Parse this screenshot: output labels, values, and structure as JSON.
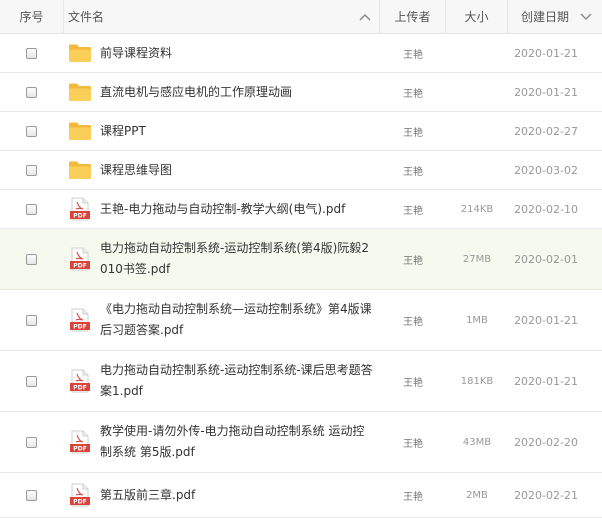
{
  "header": {
    "index": "序号",
    "name": "文件名",
    "uploader": "上传者",
    "size": "大小",
    "created": "创建日期"
  },
  "files": [
    {
      "type": "folder",
      "name": "前导课程资料",
      "uploader": "王艳",
      "size": "",
      "date": "2020-01-21"
    },
    {
      "type": "folder",
      "name": "直流电机与感应电机的工作原理动画",
      "uploader": "王艳",
      "size": "",
      "date": "2020-01-21"
    },
    {
      "type": "folder",
      "name": "课程PPT",
      "uploader": "王艳",
      "size": "",
      "date": "2020-02-27"
    },
    {
      "type": "folder",
      "name": "课程思维导图",
      "uploader": "王艳",
      "size": "",
      "date": "2020-03-02"
    },
    {
      "type": "pdf",
      "name": "王艳-电力拖动与自动控制-教学大纲(电气).pdf",
      "uploader": "王艳",
      "size": "214KB",
      "date": "2020-02-10"
    },
    {
      "type": "pdf",
      "name": "电力拖动自动控制系统-运动控制系统(第4版)阮毅2010书签.pdf",
      "uploader": "王艳",
      "size": "27MB",
      "date": "2020-02-01"
    },
    {
      "type": "pdf",
      "name": "《电力拖动自动控制系统—运动控制系统》第4版课后习题答案.pdf",
      "uploader": "王艳",
      "size": "1MB",
      "date": "2020-01-21"
    },
    {
      "type": "pdf",
      "name": "电力拖动自动控制系统-运动控制系统-课后思考题答案1.pdf",
      "uploader": "王艳",
      "size": "181KB",
      "date": "2020-01-21"
    },
    {
      "type": "pdf",
      "name": "教学使用-请勿外传-电力拖动自动控制系统 运动控制系统 第5版.pdf",
      "uploader": "王艳",
      "size": "43MB",
      "date": "2020-02-20"
    },
    {
      "type": "pdf",
      "name": "第五版前三章.pdf",
      "uploader": "王艳",
      "size": "2MB",
      "date": "2020-02-21"
    }
  ],
  "icons": {
    "folder": "folder-icon",
    "pdf": "pdf-file-icon",
    "sort": "chevron-up-icon"
  },
  "colors": {
    "folder": "#f7c84a",
    "pdf": "#d9433a",
    "highlight_row": "#f5f9ee"
  }
}
